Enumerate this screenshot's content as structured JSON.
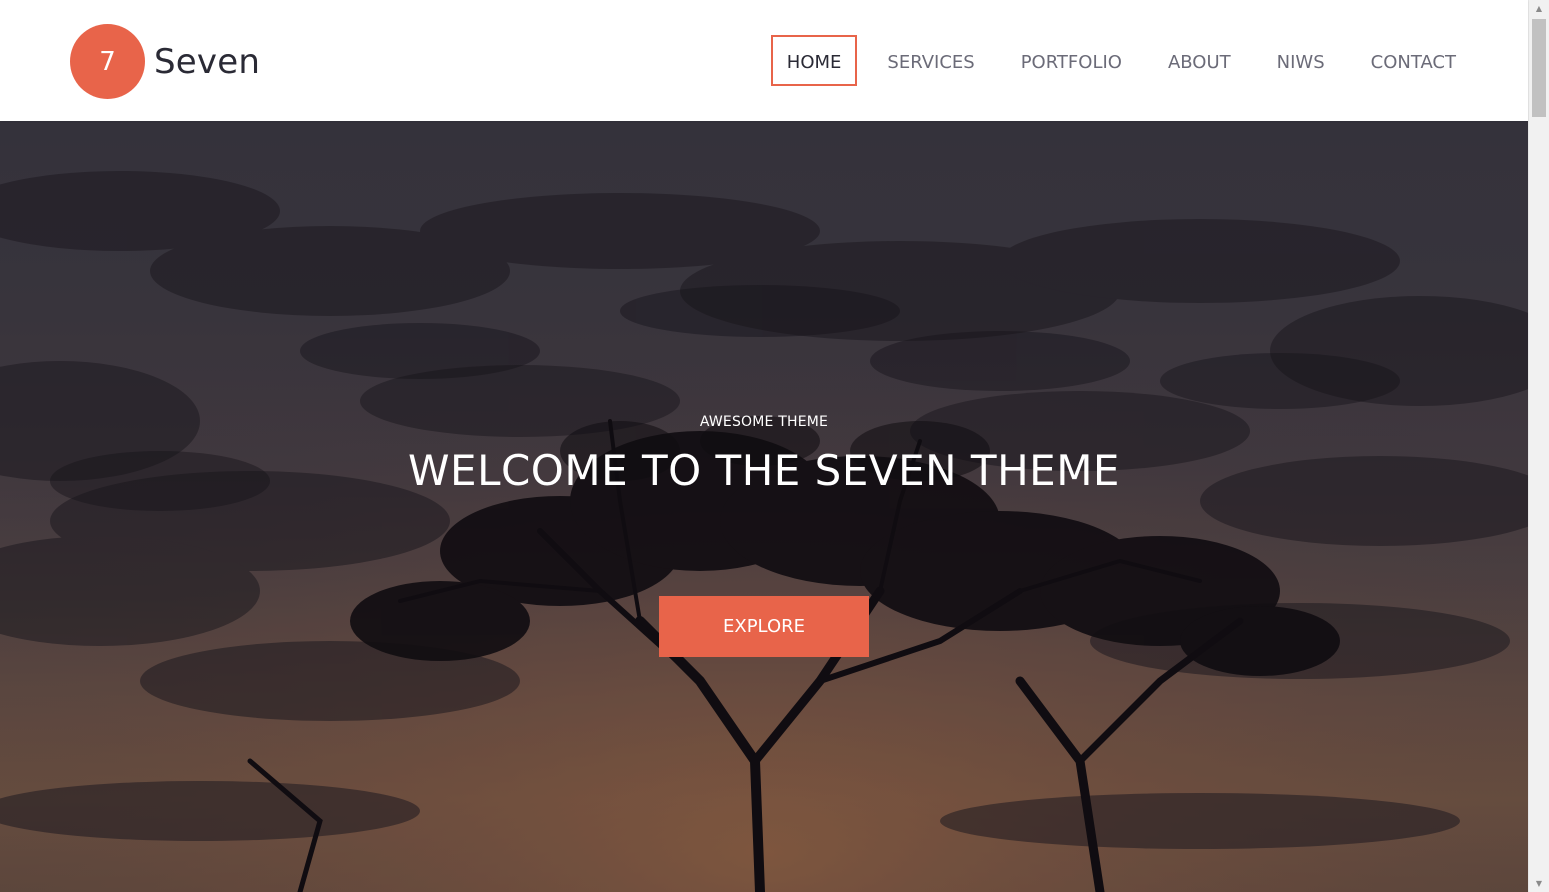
{
  "brand": {
    "badge": "7",
    "name": "Seven",
    "accent_color": "#e8644a"
  },
  "nav": {
    "items": [
      {
        "label": "HOME",
        "active": true
      },
      {
        "label": "SERVICES",
        "active": false
      },
      {
        "label": "PORTFOLIO",
        "active": false
      },
      {
        "label": "ABOUT",
        "active": false
      },
      {
        "label": "NIWS",
        "active": false
      },
      {
        "label": "CONTACT",
        "active": false
      }
    ]
  },
  "hero": {
    "eyebrow": "AWESOME THEME",
    "title": "WELCOME TO THE SEVEN THEME",
    "button_label": "EXPLORE",
    "background": "sunset-tree-silhouette"
  },
  "scrollbar": {
    "up_icon": "scroll-up-arrow-icon",
    "down_icon": "scroll-down-arrow-icon"
  }
}
